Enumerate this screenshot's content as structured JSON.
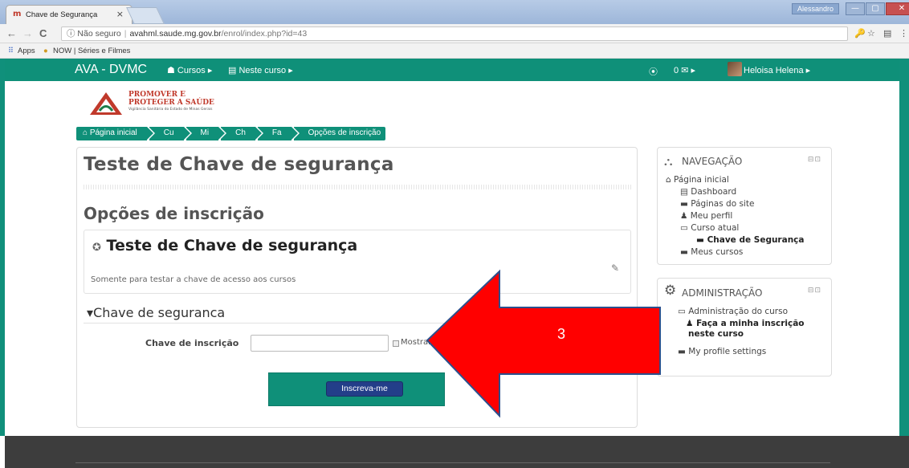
{
  "browser": {
    "tab_title": "Chave de Segurança",
    "tab_close": "×",
    "user_badge": "Alessandro",
    "window_controls": [
      "—",
      "▢",
      "✕"
    ],
    "nav": {
      "back": "←",
      "forward": "→",
      "reload": "C"
    },
    "url_security": "ⓘ Não seguro",
    "url_separator": "|",
    "url_host": "avahml.saude.mg.gov.br",
    "url_path": "/enrol/index.php?id=43",
    "toolbar_icons": [
      "🔑",
      "☆",
      "▤",
      "⋮"
    ],
    "bookmarks": [
      {
        "icon": "⠿",
        "label": "Apps"
      },
      {
        "icon": "●",
        "label": "NOW | Séries e Filmes"
      }
    ]
  },
  "navbar": {
    "brand": "AVA - DVMC",
    "courses": "☗ Cursos ▸",
    "this_course": "▤ Neste curso ▸",
    "clock_icon": "⦿",
    "messages": "0 ✉ ▸",
    "user": "Heloisa Helena ▸"
  },
  "logo": {
    "line1": "PROMOVER E",
    "line2": "PROTEGER A SAÚDE",
    "line3": "Vigilância Sanitária do Estado de Minas Gerais"
  },
  "breadcrumb": [
    {
      "label": "⌂ Página inicial"
    },
    {
      "label": "Cu"
    },
    {
      "label": "Mi"
    },
    {
      "label": "Ch"
    },
    {
      "label": "Fa"
    },
    {
      "label": "Opções de inscrição"
    }
  ],
  "main": {
    "course_heading": "Teste de Chave de segurança",
    "section_heading": "Opções de inscrição",
    "course_box": {
      "name_icon": "✪",
      "name": "Teste de Chave de segurança",
      "summary": "Somente para testar a chave de acesso aos cursos",
      "edit_icon": "✎"
    },
    "legend": "▾Chave de seguranca",
    "field_label": "Chave de inscrição",
    "field_value": "",
    "show_label": "Mostrar",
    "submit_label": "Inscreva-me"
  },
  "navigation_block": {
    "title": "NAVEGAÇÃO",
    "icon": "⛬",
    "controls": "⊟⊡",
    "items": [
      {
        "label": "⌂ Página inicial"
      },
      {
        "label": "▤ Dashboard"
      },
      {
        "label": "▬ Páginas do site"
      },
      {
        "label": "♟ Meu perfil"
      },
      {
        "label": "▭ Curso atual"
      },
      {
        "label": "▬ Chave de Segurança"
      },
      {
        "label": "▬ Meus cursos"
      }
    ]
  },
  "admin_block": {
    "title": "ADMINISTRAÇÃO",
    "icon": "⚙",
    "controls": "⊟⊡",
    "items": [
      {
        "label": "▭ Administração do curso"
      },
      {
        "label": "♟ Faça a minha inscrição"
      },
      {
        "label": "neste curso"
      },
      {
        "label": "▬ My profile settings"
      }
    ]
  },
  "annotation": {
    "number": "3",
    "color": "#ff0000"
  }
}
